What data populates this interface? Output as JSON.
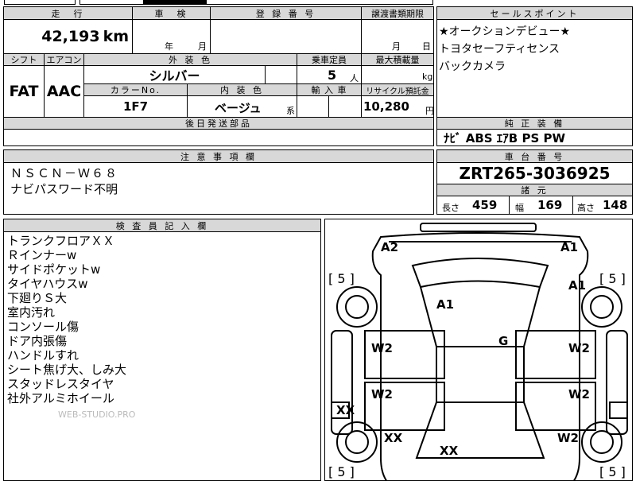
{
  "top_cut": {
    "text": "...",
    "text2": "..."
  },
  "left_table": {
    "header1": [
      "走　行",
      "車　検",
      "登 録 番 号",
      "譲渡書類期限"
    ],
    "mileage": "42,193",
    "mileage_unit": "km",
    "shaken_year": "年",
    "shaken_month": "月",
    "registration_no": "",
    "transfer_month": "月",
    "transfer_day": "日",
    "header2": [
      "シフト",
      "エアコン",
      "外 装 色",
      "乗車定員",
      "最大積載量"
    ],
    "shift": "FAT",
    "ac": "AAC",
    "exterior_color": "シルバー",
    "capacity": "5",
    "capacity_unit": "人",
    "max_load_unit": "kg",
    "header3": [
      "カラーNo.",
      "内 装 色",
      "輸 入 車",
      "リサイクル預託金"
    ],
    "color_no": "1F7",
    "interior_color": "ベージュ",
    "interior_unit": "系",
    "recycle_fee": "10,280",
    "recycle_unit": "円",
    "later_parts_header": "後日発送部品",
    "later_parts": ""
  },
  "selling_points": {
    "header": "セールスポイント",
    "items": [
      "★オークションデビュー★",
      "トヨタセーフティセンス",
      "バックカメラ"
    ]
  },
  "equipment": {
    "header": "純 正 装 備",
    "items": "ﾅﾋﾞ ABS ｴｱB PS PW"
  },
  "notes": {
    "header": "注 意 事 項 欄",
    "lines": [
      "ＮＳＣＮ－Ｗ６８",
      "ナビパスワード不明"
    ]
  },
  "chassis": {
    "header": "車 台 番 号",
    "number": "ZRT265-3036925",
    "spec_header": "諸 元",
    "length_label": "長さ",
    "length": "459",
    "width_label": "幅",
    "width": "169",
    "height_label": "高さ",
    "height": "148"
  },
  "inspector": {
    "header": "検 査 員 記 入 欄",
    "lines": [
      "トランクフロアＸＸ",
      "Ｒインナーw",
      "サイドポケットw",
      "タイヤハウスw",
      "下廻りＳ大",
      "室内汚れ",
      "コンソール傷",
      "ドア内張傷",
      "ハンドルすれ",
      "シート焦げ大、しみ大",
      "スタッドレスタイヤ",
      "社外アルミホイール"
    ],
    "watermark": "WEB-STUDIO.PRO"
  },
  "diagram": {
    "tire_depth_labels": [
      "[ 5 ]",
      "[ 5 ]",
      "[ 5 ]",
      "[ 5 ]"
    ],
    "marks": [
      "A2",
      "A1",
      "A1",
      "A1",
      "G",
      "W2",
      "W2",
      "W2",
      "W2",
      "W2",
      "XX",
      "XX",
      "XX"
    ]
  }
}
